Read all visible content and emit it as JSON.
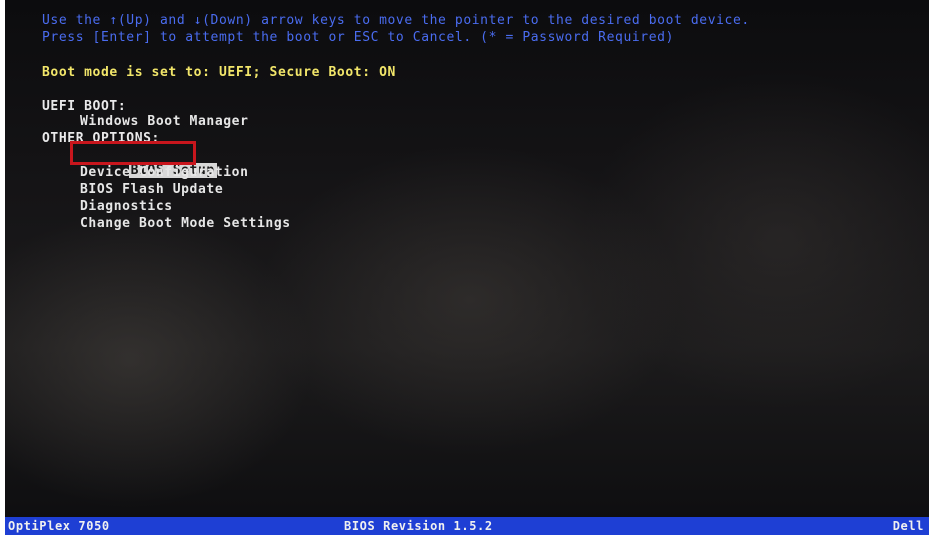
{
  "instructions": {
    "line1": "Use the ↑(Up) and ↓(Down) arrow keys to move the pointer to the desired boot device.",
    "line2": "Press [Enter] to attempt the boot or ESC to Cancel. (* = Password Required)"
  },
  "boot_mode": {
    "text": "Boot mode is set to: UEFI; Secure Boot: ON"
  },
  "uefi_boot": {
    "header": "UEFI BOOT:",
    "items": [
      "Windows Boot Manager"
    ]
  },
  "other_options": {
    "header": "OTHER OPTIONS:",
    "items": [
      "BIOS Setup",
      "Device Configuration",
      "BIOS Flash Update",
      "Diagnostics",
      "Change Boot Mode Settings"
    ],
    "selected_item": "BIOS Setup"
  },
  "status_bar": {
    "model": "OptiPlex 7050",
    "revision": "BIOS Revision 1.5.2",
    "vendor": "Dell"
  },
  "colors": {
    "instruction_text": "#4a6cf0",
    "boot_mode_text": "#f2e66a",
    "status_bar_bg": "#1e3fd4",
    "highlight_border": "#c8161d"
  }
}
